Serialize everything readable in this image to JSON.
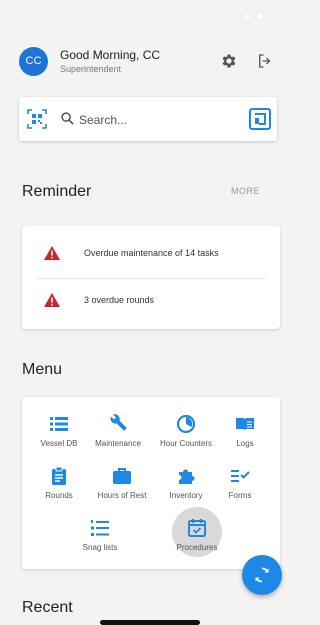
{
  "colors": {
    "accent": "#1e88e5",
    "warning": "#c62828",
    "background": "#f3f3f4"
  },
  "header": {
    "avatar_initials": "CC",
    "greeting": "Good Morning, CC",
    "role": "Superintendent",
    "settings_icon": "gear-icon",
    "logout_icon": "logout-icon"
  },
  "search": {
    "placeholder": "Search...",
    "left_icon": "qr-code-icon",
    "right_icon": "scan-icon"
  },
  "reminder": {
    "title": "Reminder",
    "more_label": "MORE",
    "items": [
      {
        "icon": "warning-icon",
        "text": "Overdue maintenance of 14 tasks"
      },
      {
        "icon": "warning-icon",
        "text": "3 overdue rounds"
      }
    ]
  },
  "menu": {
    "title": "Menu",
    "items": [
      {
        "label": "Vessel DB",
        "icon": "list-icon"
      },
      {
        "label": "Maintenance",
        "icon": "wrench-icon"
      },
      {
        "label": "Hour Counters",
        "icon": "gauge-icon"
      },
      {
        "label": "Logs",
        "icon": "book-icon"
      },
      {
        "label": "Rounds",
        "icon": "clipboard-icon"
      },
      {
        "label": "Hours of Rest",
        "icon": "briefcase-icon"
      },
      {
        "label": "Inventory",
        "icon": "puzzle-icon"
      },
      {
        "label": "Forms",
        "icon": "checklist-icon"
      },
      {
        "label": "Snag lists",
        "icon": "numbered-list-icon"
      },
      {
        "label": "Procedures",
        "icon": "calendar-check-icon"
      }
    ]
  },
  "recent": {
    "title": "Recent"
  },
  "fab": {
    "icon": "sync-icon"
  }
}
